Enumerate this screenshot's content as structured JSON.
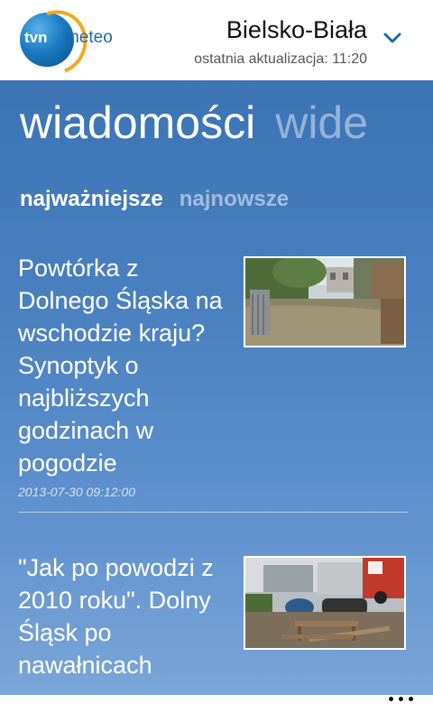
{
  "header": {
    "logo": {
      "tvn": "tvn",
      "meteo": "meteo"
    },
    "city": "Bielsko-Biała",
    "last_update": "ostatnia aktualizacja: 11:20",
    "dropdown_icon": "chevron-down-icon"
  },
  "pivot": {
    "items": [
      {
        "label": "wiadomości",
        "active": true
      },
      {
        "label": "wide",
        "active": false
      }
    ]
  },
  "subtabs": [
    {
      "label": "najważniejsze",
      "active": true
    },
    {
      "label": "najnowsze",
      "active": false
    }
  ],
  "news": [
    {
      "title": "Powtórka z Dolnego Śląska na wschodzie kraju? Synoptyk o najbliższych godzinach w pogodzie",
      "date": "2013-07-30 09:12:00",
      "thumbnail": "flooded-street-photo"
    },
    {
      "title": "\"Jak po powodzi z 2010 roku\". Dolny Śląsk po nawałnicach",
      "date": "",
      "thumbnail": "flood-aftermath-photo"
    }
  ],
  "appbar": {
    "more_icon": "more-dots-icon"
  },
  "colors": {
    "accent": "#1a6aa8",
    "background_top": "#3b73b5",
    "background_bottom": "#7aa6d8"
  }
}
